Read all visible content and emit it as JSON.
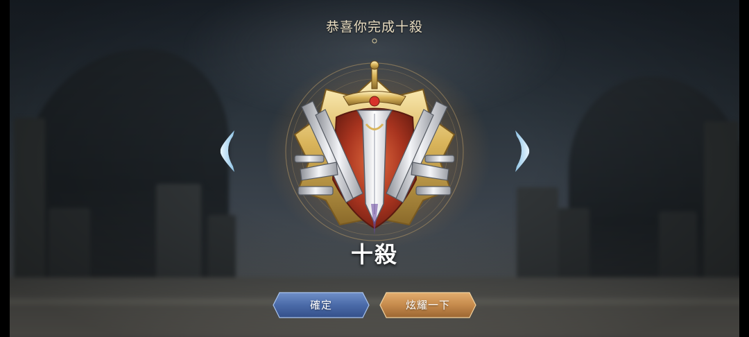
{
  "header": {
    "title": "恭喜你完成十殺"
  },
  "achievement": {
    "name": "十殺",
    "badge_icon": "crossed-swords-emblem-icon"
  },
  "navigation": {
    "prev_icon": "chevron-left-icon",
    "next_icon": "chevron-right-icon"
  },
  "actions": {
    "confirm_label": "確定",
    "share_label": "炫耀一下"
  },
  "colors": {
    "title_text": "#e8dcc0",
    "confirm_button": "#4a6aa8",
    "share_button": "#c58a4c",
    "badge_gold": "#d9b45a",
    "badge_red": "#a8341f"
  }
}
